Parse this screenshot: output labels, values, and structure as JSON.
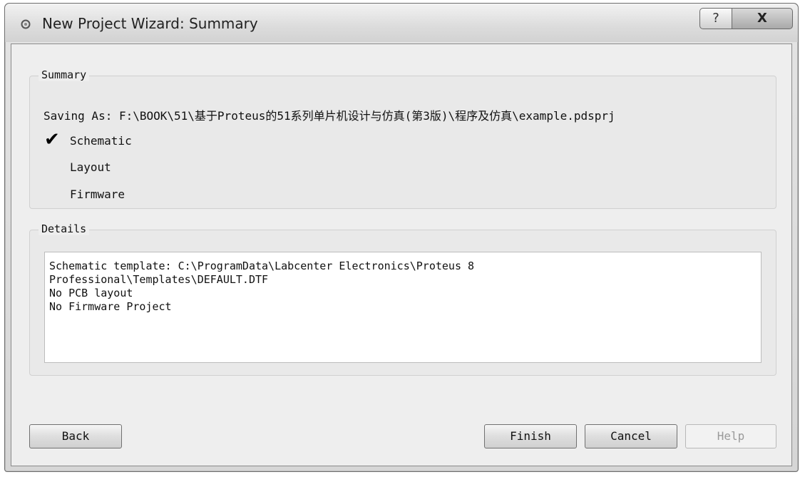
{
  "window": {
    "title": "New Project Wizard: Summary",
    "help_glyph": "?",
    "close_glyph": "X"
  },
  "summary": {
    "group_label": "Summary",
    "saving_as": "Saving As:  F:\\BOOK\\51\\基于Proteus的51系列单片机设计与仿真(第3版)\\程序及仿真\\example.pdsprj",
    "check_glyph": "✔",
    "options": [
      {
        "label": "Schematic",
        "checked": true
      },
      {
        "label": "Layout",
        "checked": false
      },
      {
        "label": "Firmware",
        "checked": false
      }
    ]
  },
  "details": {
    "group_label": "Details",
    "lines": [
      "Schematic template: C:\\ProgramData\\Labcenter Electronics\\Proteus 8",
      "Professional\\Templates\\DEFAULT.DTF",
      "No PCB layout",
      "No Firmware Project"
    ]
  },
  "buttons": {
    "back": "Back",
    "finish": "Finish",
    "cancel": "Cancel",
    "help": "Help",
    "help_enabled": false
  }
}
